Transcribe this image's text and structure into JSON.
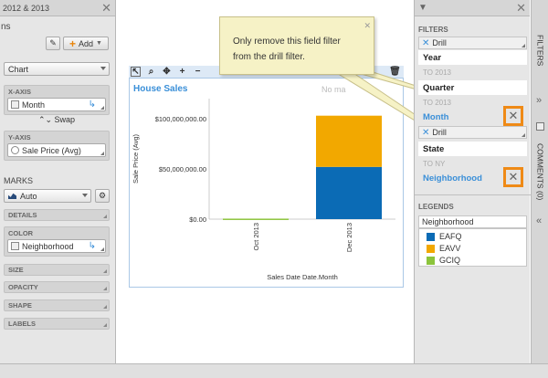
{
  "left_panel": {
    "title": "2012 & 2013",
    "section_label": "ns",
    "add_label": "Add",
    "chart_type": "Chart",
    "xaxis": {
      "header": "X-AXIS",
      "field": "Month"
    },
    "swap_label": "Swap",
    "yaxis": {
      "header": "Y-AXIS",
      "field": "Sale Price (Avg)"
    },
    "marks_label": "MARKS",
    "marks_type": "Auto",
    "details_header": "DETAILS",
    "color": {
      "header": "COLOR",
      "field": "Neighborhood"
    },
    "collapsed": [
      "SIZE",
      "OPACITY",
      "SHAPE",
      "LABELS"
    ]
  },
  "chart": {
    "title": "House Sales",
    "no_marks_text": "No ma",
    "ylabel": "Sale Price (Avg)",
    "xlabel": "Sales Date Date.Month",
    "yticks": [
      "$100,000,000.00",
      "$50,000,000.00",
      "$0.00"
    ],
    "xticks": [
      "Oct 2013",
      "Dec 2013"
    ]
  },
  "chart_data": {
    "type": "bar",
    "categories": [
      "Oct 2013",
      "Dec 2013"
    ],
    "series": [
      {
        "name": "EAFQ",
        "color": "#0b6bb5",
        "values": [
          0,
          52000000
        ]
      },
      {
        "name": "EAVV",
        "color": "#f2a800",
        "values": [
          0,
          51000000
        ]
      },
      {
        "name": "GCIQ",
        "color": "#8cc43c",
        "values": [
          500000,
          0
        ]
      }
    ],
    "xlabel": "Sales Date Date.Month",
    "ylabel": "Sale Price (Avg)",
    "ylim": [
      0,
      120000000
    ],
    "legend": "right"
  },
  "tooltip": {
    "text_line1": "Only remove this field filter",
    "text_line2": "from the drill filter."
  },
  "filters": {
    "header": "FILTERS",
    "drill1": "Drill",
    "year_label": "Year",
    "year_value": "TO 2013",
    "quarter_label": "Quarter",
    "quarter_value": "TO 2013",
    "month_link": "Month",
    "drill2": "Drill",
    "state_label": "State",
    "state_value": "TO NY",
    "neighborhood_link": "Neighborhood"
  },
  "legends": {
    "header": "LEGENDS",
    "title": "Neighborhood",
    "items": [
      {
        "label": "EAFQ",
        "color": "#0b6bb5"
      },
      {
        "label": "EAVV",
        "color": "#f2a800"
      },
      {
        "label": "GCIQ",
        "color": "#8cc43c"
      }
    ]
  },
  "side_tabs": {
    "filters": "FILTERS",
    "comments": "COMMENTS (0)"
  }
}
